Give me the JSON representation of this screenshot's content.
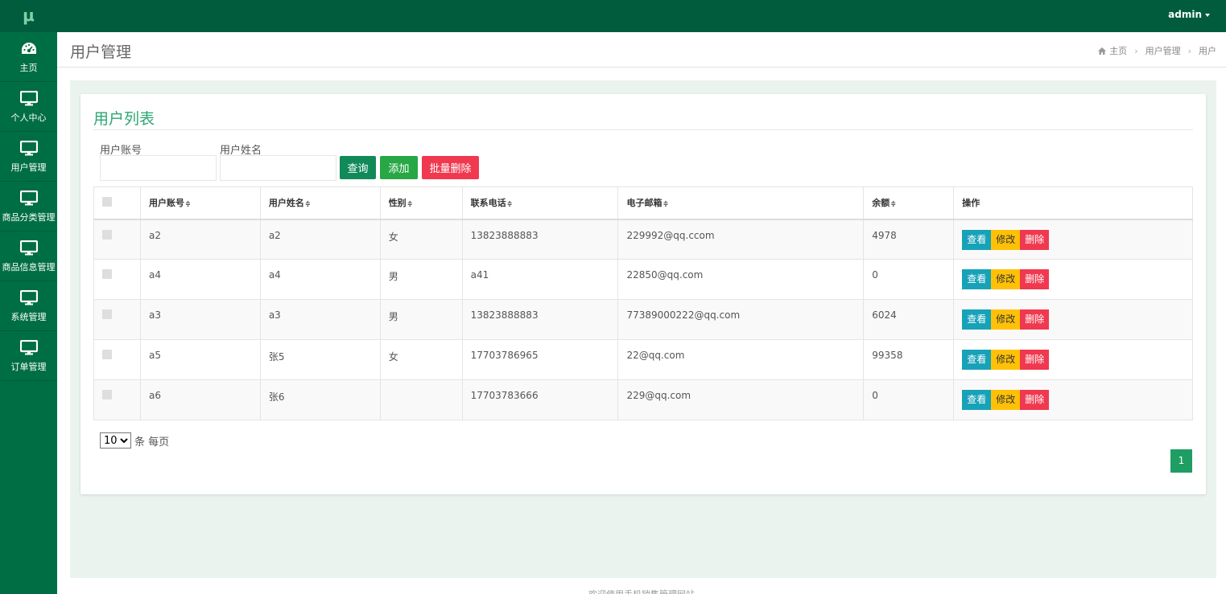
{
  "app": {
    "logo": "μ",
    "user_label": "admin"
  },
  "sidebar": {
    "items": [
      {
        "label": "主页",
        "icon": "dashboard-icon"
      },
      {
        "label": "个人中心",
        "icon": "monitor-icon"
      },
      {
        "label": "用户管理",
        "icon": "monitor-icon"
      },
      {
        "label": "商品分类管理",
        "icon": "monitor-icon"
      },
      {
        "label": "商品信息管理",
        "icon": "monitor-icon"
      },
      {
        "label": "系统管理",
        "icon": "monitor-icon"
      },
      {
        "label": "订单管理",
        "icon": "monitor-icon"
      }
    ]
  },
  "header": {
    "title": "用户管理",
    "breadcrumb": [
      "主页",
      "用户管理",
      "用户"
    ]
  },
  "card": {
    "title": "用户列表"
  },
  "search": {
    "account_label": "用户账号",
    "account_value": "",
    "name_label": "用户姓名",
    "name_value": "",
    "query_button": "查询",
    "add_button": "添加",
    "batch_delete_button": "批量删除"
  },
  "table": {
    "sort_icon": "≑",
    "columns": [
      "用户账号",
      "用户姓名",
      "性别",
      "联系电话",
      "电子邮箱",
      "余额",
      "操作"
    ],
    "rows": [
      {
        "account": "a2",
        "name": "a2",
        "gender": "女",
        "phone": "13823888883",
        "email": "229992@qq.ccom",
        "balance": "4978"
      },
      {
        "account": "a4",
        "name": "a4",
        "gender": "男",
        "phone": "a41",
        "email": "22850@qq.com",
        "balance": "0"
      },
      {
        "account": "a3",
        "name": "a3",
        "gender": "男",
        "phone": "13823888883",
        "email": "77389000222@qq.com",
        "balance": "6024"
      },
      {
        "account": "a5",
        "name": "张5",
        "gender": "女",
        "phone": "17703786965",
        "email": "22@qq.com",
        "balance": "99358"
      },
      {
        "account": "a6",
        "name": "张6",
        "gender": "",
        "phone": "17703783666",
        "email": "229@qq.com",
        "balance": "0"
      }
    ],
    "actions": {
      "view": "查看",
      "edit": "修改",
      "delete": "删除"
    }
  },
  "pagination": {
    "page_size": "10",
    "per_page_label": "条 每页",
    "current_page": "1"
  },
  "footer": {
    "text": "欢迎使用手机销售管理网站"
  },
  "colors": {
    "sidebar": "#006e45",
    "topbar": "#005c3c",
    "accent": "#2aa772",
    "query": "#118a5a",
    "add": "#28a745",
    "danger": "#f0394f",
    "view": "#17a2b8",
    "edit": "#ffc107"
  }
}
